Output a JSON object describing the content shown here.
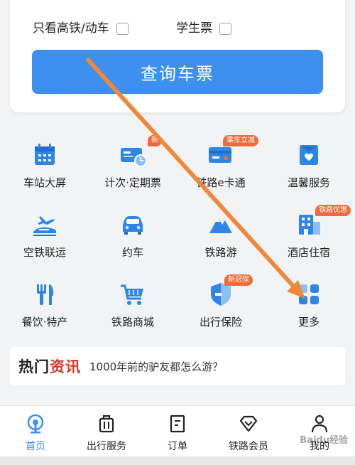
{
  "query_card": {
    "option_high_speed": "只看高铁/动车",
    "option_student": "学生票",
    "query_button": "查询车票"
  },
  "grid": {
    "items": [
      {
        "label": "车站大屏",
        "icon": "calendar-icon",
        "badge": ""
      },
      {
        "label": "计次·定期票",
        "icon": "ticket-card-icon",
        "badge": "新"
      },
      {
        "label": "铁路e卡通",
        "icon": "e-card-icon",
        "badge": "乘车立减"
      },
      {
        "label": "温馨服务",
        "icon": "heart-box-icon",
        "badge": ""
      },
      {
        "label": "空铁联运",
        "icon": "plane-train-icon",
        "badge": ""
      },
      {
        "label": "约车",
        "icon": "car-icon",
        "badge": ""
      },
      {
        "label": "铁路游",
        "icon": "mountain-icon",
        "badge": ""
      },
      {
        "label": "酒店住宿",
        "icon": "hotel-icon",
        "badge": "铁路优惠"
      },
      {
        "label": "餐饮·特产",
        "icon": "fork-knife-icon",
        "badge": ""
      },
      {
        "label": "铁路商城",
        "icon": "shopping-cart-icon",
        "badge": ""
      },
      {
        "label": "出行保险",
        "icon": "shield-icon",
        "badge": "新冠保"
      },
      {
        "label": "更多",
        "icon": "more-grid-icon",
        "badge": ""
      }
    ]
  },
  "news": {
    "tag_prefix": "热门",
    "tag_suffix": "资讯",
    "headline": "1000年前的驴友都怎么游？"
  },
  "tabbar": {
    "tabs": [
      {
        "label": "首页",
        "icon": "home-train-icon",
        "active": true
      },
      {
        "label": "出行服务",
        "icon": "luggage-icon",
        "active": false
      },
      {
        "label": "订单",
        "icon": "order-list-icon",
        "active": false
      },
      {
        "label": "铁路会员",
        "icon": "diamond-icon",
        "active": false
      },
      {
        "label": "我的",
        "icon": "user-icon",
        "active": false
      }
    ]
  },
  "watermark": "Baidu经验",
  "colors": {
    "accent": "#3d8ff0",
    "badge": "#f06b3c",
    "arrow": "#f0883a"
  }
}
